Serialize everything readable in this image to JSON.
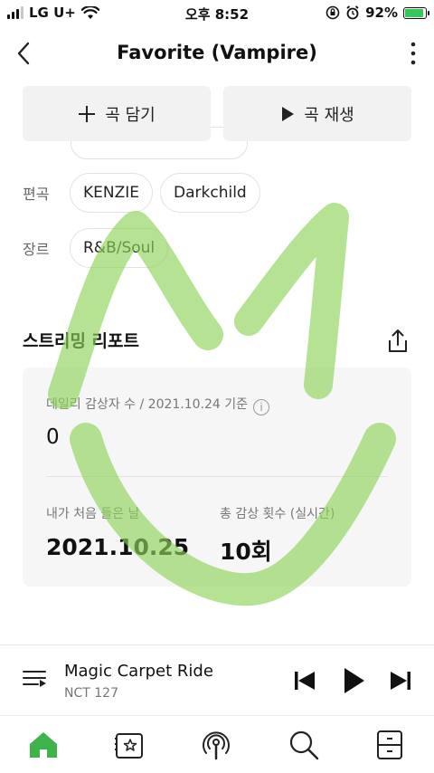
{
  "status_bar": {
    "carrier": "LG U+",
    "time": "오후 8:52",
    "battery_percent": "92%",
    "battery_level": 0.92
  },
  "header": {
    "title": "Favorite (Vampire)",
    "back_icon": "chevron-left-icon",
    "more_icon": "more-vertical-icon"
  },
  "actions": {
    "add_label": "곡 담기",
    "play_label": "곡 재생"
  },
  "credits": {
    "arranger_label": "편곡",
    "arrangers": [
      "KENZIE",
      "Darkchild"
    ],
    "genre_label": "장르",
    "genres": [
      "R&B/Soul"
    ]
  },
  "report": {
    "title": "스트리밍 리포트",
    "daily_label": "데일리 감상자 수 / 2021.10.24 기준",
    "daily_value": "0",
    "first_listen_label": "내가 처음 들은 날",
    "first_listen_value": "2021.10.25",
    "total_plays_label": "총 감상 횟수 (실시간)",
    "total_plays_value": "10회"
  },
  "player": {
    "track_title": "Magic Carpet Ride",
    "artist": "NCT 127"
  },
  "tabs": [
    "home-icon",
    "library-icon",
    "podcast-icon",
    "search-icon",
    "drawer-icon"
  ],
  "colors": {
    "accent": "#3cb44a",
    "watermark": "#8fd35a"
  }
}
